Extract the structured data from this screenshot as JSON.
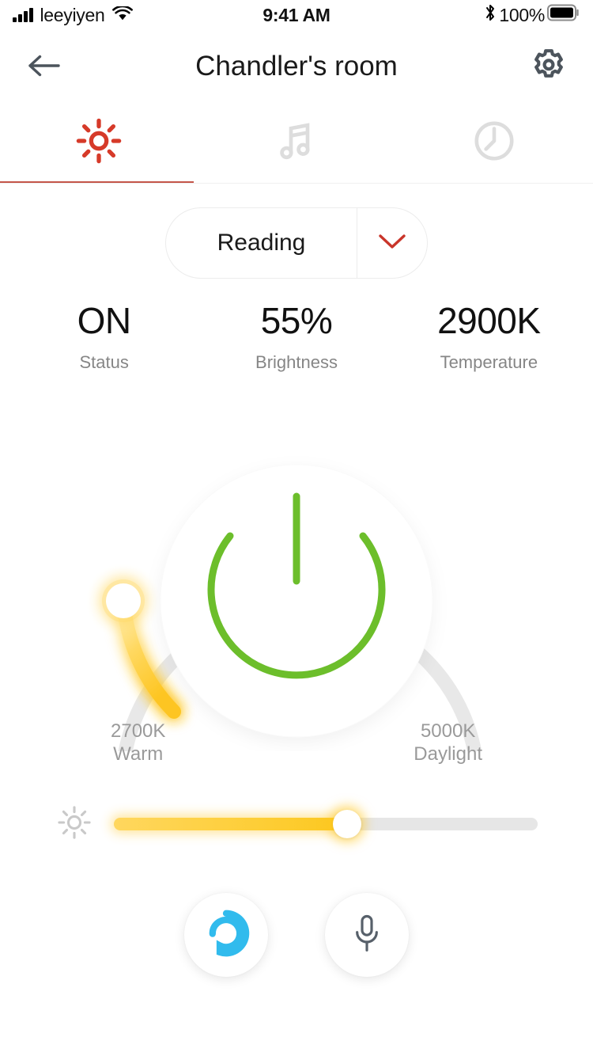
{
  "status_bar": {
    "carrier": "leeyiyen",
    "signal_icon": "cellular-signal-icon",
    "wifi_icon": "wifi-icon",
    "time": "9:41 AM",
    "bluetooth_icon": "bluetooth-icon",
    "battery_percent": "100%",
    "battery_icon": "battery-full-icon"
  },
  "nav": {
    "back_icon": "back-arrow-icon",
    "title": "Chandler's room",
    "settings_icon": "gear-icon"
  },
  "tabs": [
    {
      "id": "light",
      "icon": "sun-icon",
      "active": true,
      "color": "#d63a29"
    },
    {
      "id": "music",
      "icon": "music-note-icon",
      "active": false,
      "color": "#dddddd"
    },
    {
      "id": "timer",
      "icon": "clock-icon",
      "active": false,
      "color": "#dddddd"
    }
  ],
  "scene": {
    "label": "Reading",
    "caret_icon": "chevron-down-icon",
    "caret_color": "#c9352a"
  },
  "stats": [
    {
      "value": "ON",
      "label": "Status"
    },
    {
      "value": "55%",
      "label": "Brightness"
    },
    {
      "value": "2900K",
      "label": "Temperature"
    }
  ],
  "dial": {
    "power_icon": "power-icon",
    "power_color": "#6cbe2b",
    "track_color": "#e8e8e8",
    "fill_color": "#ffc927",
    "knob_icon": "dial-knob-handle",
    "value_kelvin": "2900K",
    "min": {
      "value": "2700K",
      "name": "Warm"
    },
    "max": {
      "value": "5000K",
      "name": "Daylight"
    }
  },
  "brightness_slider": {
    "icon": "brightness-sun-icon",
    "value_percent": 55,
    "fill_color": "#fcc81f",
    "track_color": "#e6e6e6"
  },
  "bottom_buttons": [
    {
      "id": "alexa",
      "icon": "alexa-icon",
      "color": "#31bbed"
    },
    {
      "id": "microphone",
      "icon": "microphone-icon",
      "color": "#57606a"
    }
  ]
}
